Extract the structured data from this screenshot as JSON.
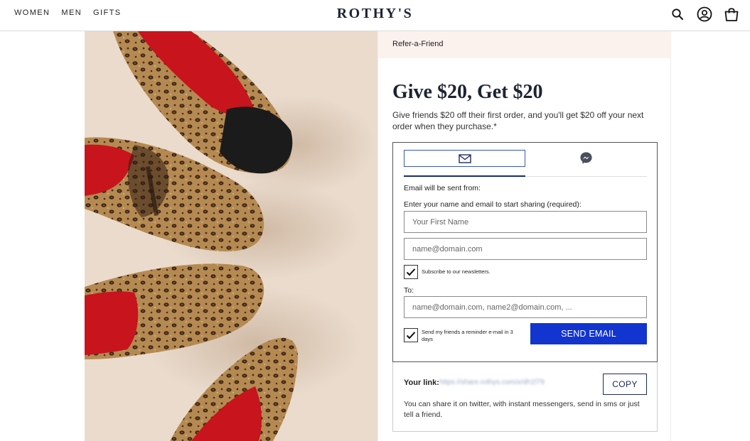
{
  "nav": {
    "links": [
      "WOMEN",
      "MEN",
      "GIFTS"
    ],
    "brand": "ROTHY'S",
    "icons": [
      "search-icon",
      "account-icon",
      "bag-icon"
    ]
  },
  "breadcrumb": "Refer-a-Friend",
  "offer": {
    "heading": "Give $20, Get $20",
    "description": "Give friends $20 off their first order, and you'll get $20 off your next order when they purchase.*"
  },
  "share": {
    "tabs": [
      "email-icon",
      "messenger-icon"
    ],
    "sent_from_label": "Email will be sent from:",
    "enter_label": "Enter your name and email to start sharing (required):",
    "first_name_placeholder": "Your First Name",
    "email_placeholder": "name@domain.com",
    "subscribe_label": "Subscribe to our newsletters.",
    "subscribe_checked": true,
    "to_label": "To:",
    "to_placeholder": "name@domain.com, name2@domain.com, ...",
    "reminder_label": "Send my friends a reminder e-mail in 3 days",
    "reminder_checked": true,
    "send_button": "SEND EMAIL"
  },
  "link": {
    "label": "Your link:",
    "value": "https://share.rothys.com/x/dh1f79",
    "copy_button": "COPY",
    "help": "You can share it on twitter, with instant messengers, send in sms or just tell a friend."
  },
  "colors": {
    "accent": "#1234cf",
    "brand_navy": "#1c2333",
    "breadcrumb_bg": "#fbf2ee",
    "hero_bg": "#eadbcd"
  }
}
